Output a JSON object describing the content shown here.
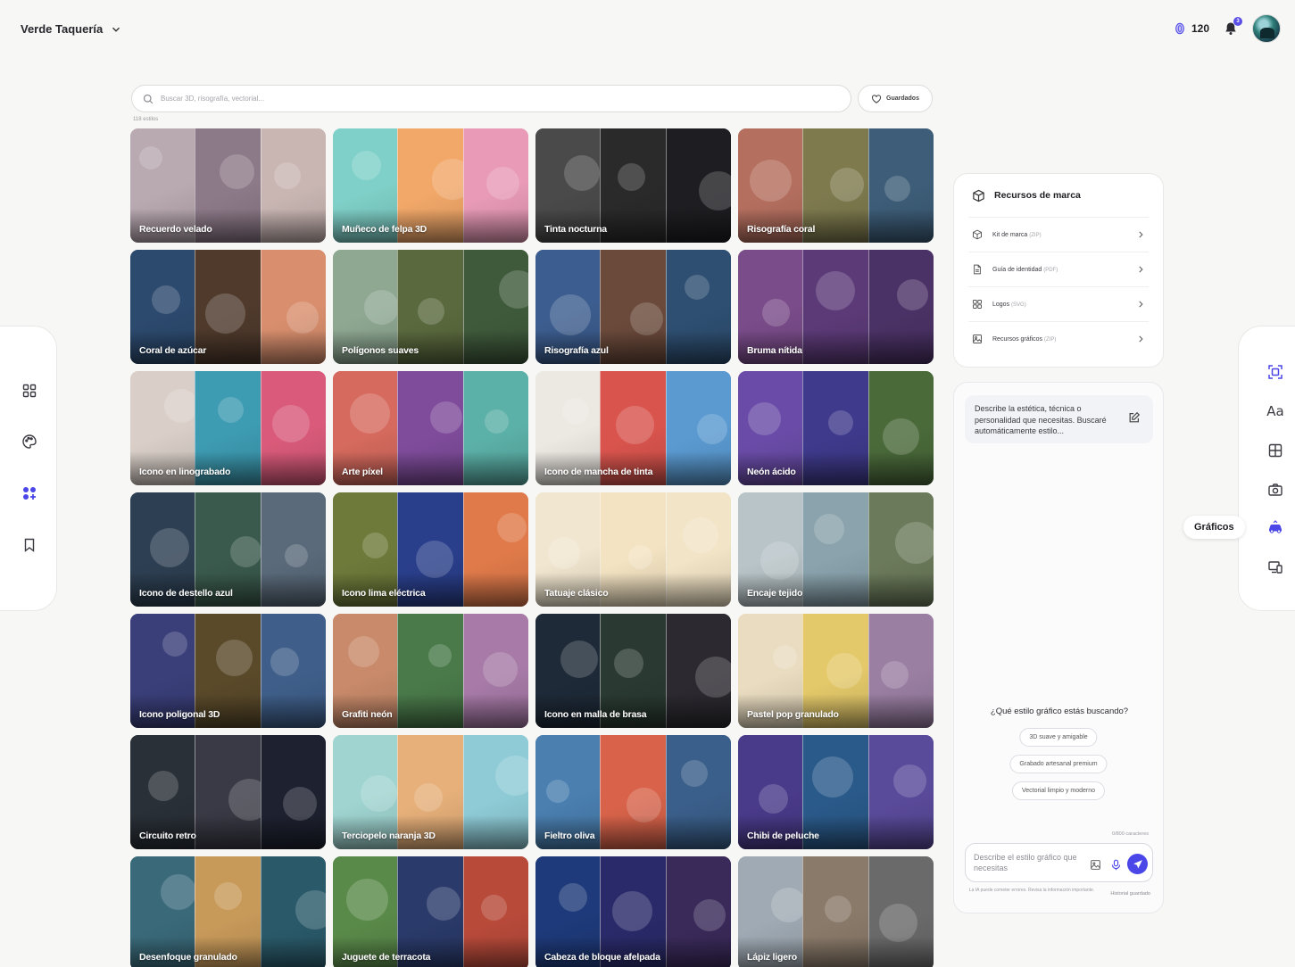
{
  "header": {
    "workspace_name": "Verde Taquería",
    "credits": "120",
    "notifications_count": "3"
  },
  "search": {
    "placeholder": "Buscar 3D, risografía, vectorial...",
    "saved_label": "Guardados",
    "results_count": "118 estilos"
  },
  "styles": [
    {
      "name": "Recuerdo velado",
      "palette": [
        "#b9a9b1",
        "#8d7a89",
        "#c9b6b3"
      ]
    },
    {
      "name": "Muñeco de felpa 3D",
      "palette": [
        "#7fd0c8",
        "#f2a869",
        "#e89ab6"
      ]
    },
    {
      "name": "Tinta nocturna",
      "palette": [
        "#4a4a4a",
        "#2a2a2a",
        "#1e1e22"
      ]
    },
    {
      "name": "Risografía coral",
      "palette": [
        "#b56f5f",
        "#7e7a4e",
        "#3d5d78"
      ]
    },
    {
      "name": "Coral de azúcar",
      "palette": [
        "#2c4a6e",
        "#4f3a2c",
        "#d98f6e"
      ]
    },
    {
      "name": "Polígonos suaves",
      "palette": [
        "#8ea892",
        "#5b6a3e",
        "#3f5a3b"
      ]
    },
    {
      "name": "Risografía azul",
      "palette": [
        "#3c5d8f",
        "#6b4a3b",
        "#2e4f72"
      ]
    },
    {
      "name": "Bruma nítida",
      "palette": [
        "#7a4c8a",
        "#5c3a78",
        "#4b3266"
      ]
    },
    {
      "name": "Icono en linograbado",
      "palette": [
        "#d9cfc8",
        "#3d9bb2",
        "#d95a7a"
      ]
    },
    {
      "name": "Arte píxel",
      "palette": [
        "#d66a5e",
        "#7f4c9b",
        "#5bb0a7"
      ]
    },
    {
      "name": "Icono de mancha de tinta",
      "palette": [
        "#ece8e2",
        "#d9544d",
        "#5a9ad1"
      ]
    },
    {
      "name": "Neón ácido",
      "palette": [
        "#6a4ca8",
        "#3f3a8c",
        "#4a6a3a"
      ]
    },
    {
      "name": "Icono de destello azul",
      "palette": [
        "#2d3f52",
        "#3a5a4d",
        "#5a6a7a"
      ]
    },
    {
      "name": "Icono lima eléctrica",
      "palette": [
        "#6e7a3a",
        "#2a3f8c",
        "#e07a4a"
      ]
    },
    {
      "name": "Tatuaje clásico",
      "palette": [
        "#f1e6cf",
        "#f3e3c2",
        "#f2e4c6"
      ]
    },
    {
      "name": "Encaje tejido",
      "palette": [
        "#b8c4c8",
        "#8aa3ad",
        "#6b7a5a"
      ]
    },
    {
      "name": "Icono poligonal 3D",
      "palette": [
        "#3a3f7a",
        "#5a4a2a",
        "#3f5f8a"
      ]
    },
    {
      "name": "Grafiti neón",
      "palette": [
        "#c88a6a",
        "#4a7a4a",
        "#a77aa7"
      ]
    },
    {
      "name": "Icono en malla de brasa",
      "palette": [
        "#1e2a38",
        "#2a3a32",
        "#2c2a30"
      ]
    },
    {
      "name": "Pastel pop granulado",
      "palette": [
        "#e9dcc0",
        "#e4c96a",
        "#9a7fa3"
      ]
    },
    {
      "name": "Circuito retro",
      "palette": [
        "#2a3038",
        "#3a3a46",
        "#1e2230"
      ]
    },
    {
      "name": "Terciopelo naranja 3D",
      "palette": [
        "#9fd4d0",
        "#e7b07a",
        "#8ecbd6"
      ]
    },
    {
      "name": "Fieltro oliva",
      "palette": [
        "#4a7fb0",
        "#d8634a",
        "#3a5f8a"
      ]
    },
    {
      "name": "Chibi de peluche",
      "palette": [
        "#4a3a8a",
        "#2a5a8a",
        "#5a4a9a"
      ]
    },
    {
      "name": "Desenfoque granulado",
      "palette": [
        "#3a6a7a",
        "#c89a5a",
        "#2a5a6a"
      ]
    },
    {
      "name": "Juguete de terracota",
      "palette": [
        "#5a8a4a",
        "#2a3a6a",
        "#b84a3a"
      ]
    },
    {
      "name": "Cabeza de bloque afelpada",
      "palette": [
        "#1e3a7a",
        "#2a2a6a",
        "#3a2a5a"
      ]
    },
    {
      "name": "Lápiz ligero",
      "palette": [
        "#a0aab4",
        "#8a7a6a",
        "#6a6a6a"
      ]
    }
  ],
  "brand_resources": {
    "title": "Recursos de marca",
    "items": [
      {
        "label": "Kit de marca",
        "format": "(ZIP)",
        "icon": "box-icon"
      },
      {
        "label": "Guía de identidad",
        "format": "(PDF)",
        "icon": "document-icon"
      },
      {
        "label": "Logos",
        "format": "(SVG)",
        "icon": "grid-icon"
      },
      {
        "label": "Recursos gráficos",
        "format": "(ZIP)",
        "icon": "image-icon"
      }
    ]
  },
  "assistant": {
    "intro": "Describe la estética, técnica o personalidad que necesitas. Buscaré automáticamente estilo...",
    "question": "¿Qué estilo gráfico estás buscando?",
    "suggestions": [
      "3D suave y amigable",
      "Grabado artesanal premium",
      "Vectorial limpio y moderno"
    ],
    "char_counter": "0/800 caracteres",
    "input_placeholder": "Describe el estilo gráfico que necesitas",
    "disclaimer": "La IA puede cometer errores. Revisa la información importante.",
    "history": "Historial guardado"
  },
  "right_toolbar": {
    "tooltip": "Gráficos",
    "text_tool": "Aa"
  },
  "colors": {
    "accent": "#4a46e8",
    "background": "#f7f7f5"
  }
}
